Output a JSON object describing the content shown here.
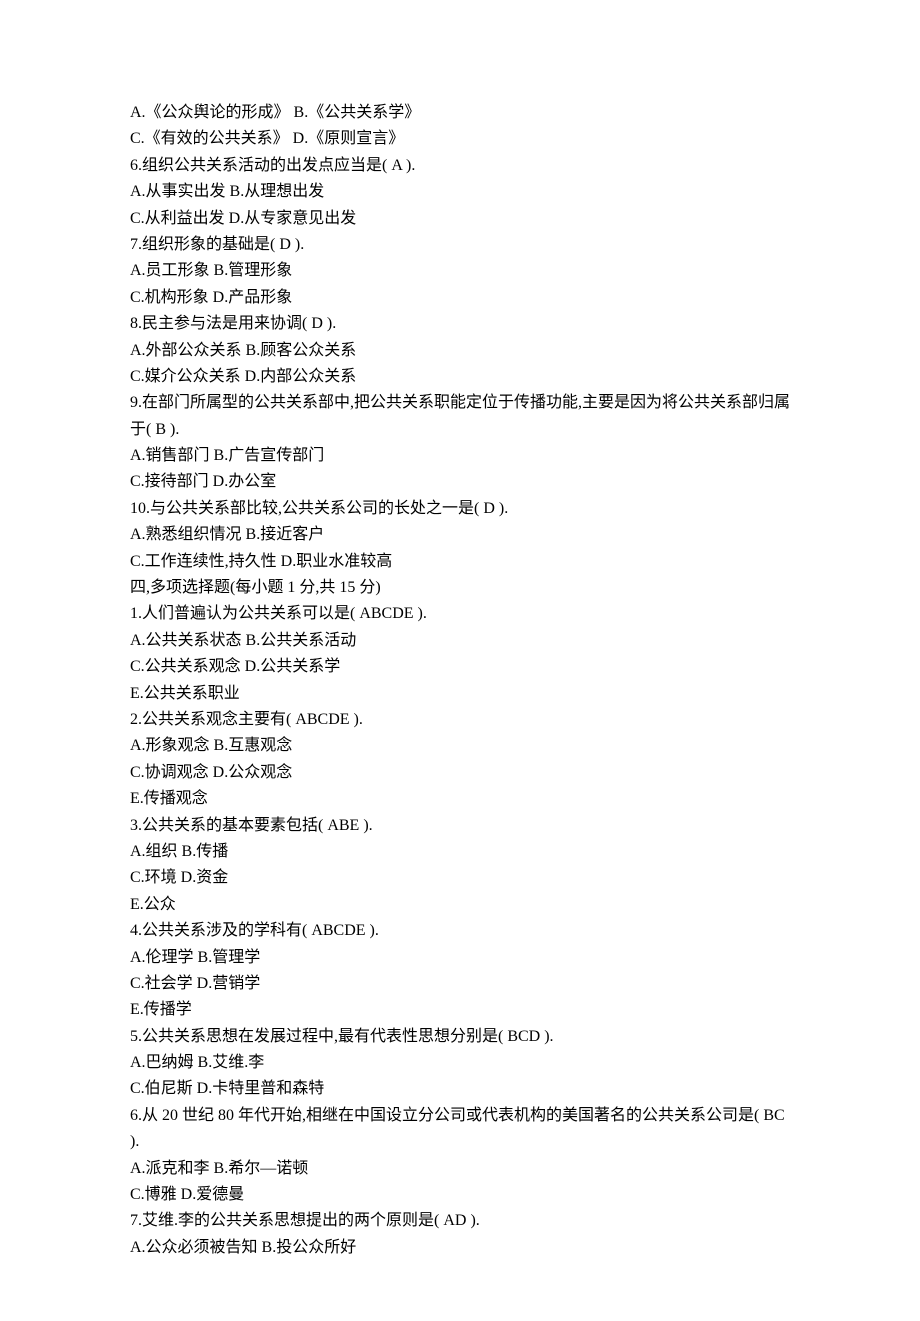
{
  "lines": [
    "A.《公众舆论的形成》  B.《公共关系学》",
    "C.《有效的公共关系》  D.《原则宣言》",
    "6.组织公共关系活动的出发点应当是( A ).",
    "A.从事实出发  B.从理想出发",
    "C.从利益出发  D.从专家意见出发",
    "7.组织形象的基础是( D ).",
    "A.员工形象  B.管理形象",
    "C.机构形象  D.产品形象",
    "8.民主参与法是用来协调( D ).",
    "A.外部公众关系  B.顾客公众关系",
    "C.媒介公众关系  D.内部公众关系",
    "9.在部门所属型的公共关系部中,把公共关系职能定位于传播功能,主要是因为将公共关系部归属于( B ).",
    "A.销售部门  B.广告宣传部门",
    "C.接待部门  D.办公室",
    "10.与公共关系部比较,公共关系公司的长处之一是( D ).",
    "A.熟悉组织情况  B.接近客户",
    "C.工作连续性,持久性  D.职业水准较高",
    "四,多项选择题(每小题 1 分,共 15 分)",
    "1.人们普遍认为公共关系可以是( ABCDE ).",
    "A.公共关系状态  B.公共关系活动",
    "C.公共关系观念  D.公共关系学",
    "E.公共关系职业",
    "2.公共关系观念主要有( ABCDE ).",
    "A.形象观念  B.互惠观念",
    "C.协调观念  D.公众观念",
    "E.传播观念",
    "3.公共关系的基本要素包括( ABE ).",
    "A.组织  B.传播",
    "C.环境  D.资金",
    "E.公众",
    "4.公共关系涉及的学科有( ABCDE ).",
    "A.伦理学  B.管理学",
    "C.社会学  D.营销学",
    "E.传播学",
    "5.公共关系思想在发展过程中,最有代表性思想分别是( BCD ).",
    "A.巴纳姆  B.艾维.李",
    "C.伯尼斯  D.卡特里普和森特",
    "6.从 20 世纪 80 年代开始,相继在中国设立分公司或代表机构的美国著名的公共关系公司是( BC ).",
    "A.派克和李  B.希尔—诺顿",
    "C.博雅  D.爱德曼",
    "7.艾维.李的公共关系思想提出的两个原则是( AD ).",
    "A.公众必须被告知  B.投公众所好"
  ]
}
